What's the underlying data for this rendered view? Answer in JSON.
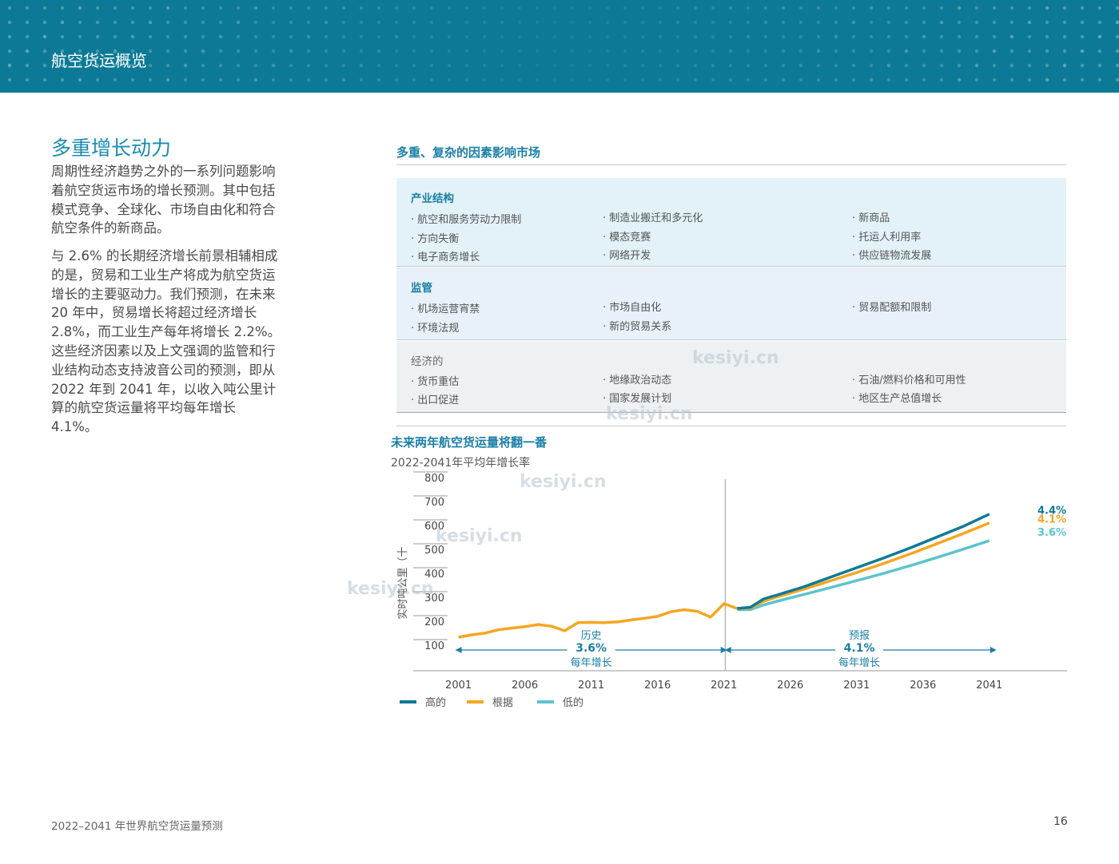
{
  "header": {
    "title": "航空货运概览"
  },
  "left": {
    "heading": "多重增长动力",
    "paragraph1": "周期性经济趋势之外的一系列问题影响着航空货运市场的增长预测。其中包括模式竞争、全球化、市场自由化和符合航空条件的新商品。",
    "paragraph2": "与 2.6% 的长期经济增长前景相辅相成的是，贸易和工业生产将成为航空货运增长的主要驱动力。我们预测，在未来 20 年中，贸易增长将超过经济增长 2.8%，而工业生产每年将增长 2.2%。这些经济因素以及上文强调的监管和行业结构动态支持波音公司的预测，即从 2022 年到 2041 年，以收入吨公里计算的航空货运量将平均每年增长 4.1%。"
  },
  "factors": {
    "title": "多重、复杂的因素影响市场",
    "industry": {
      "title": "产业结构",
      "col1": [
        "航空和服务劳动力限制",
        "方向失衡",
        "电子商务增长"
      ],
      "col2": [
        "制造业搬迁和多元化",
        "模态竞赛",
        "网络开发"
      ],
      "col3": [
        "新商品",
        "托运人利用率",
        "供应链物流发展"
      ]
    },
    "regulation": {
      "title": "监管",
      "col1": [
        "机场运营宵禁",
        "环境法规"
      ],
      "col2": [
        "市场自由化",
        "新的贸易关系"
      ],
      "col3": [
        "贸易配额和限制"
      ]
    },
    "economic": {
      "title": "经济的",
      "col1": [
        "货币重估",
        "出口促进"
      ],
      "col2": [
        "地缘政治动态",
        "国家发展计划"
      ],
      "col3": [
        "石油/燃料价格和可用性",
        "地区生产总值增长"
      ]
    }
  },
  "chart": {
    "title": "未来两年航空货运量将翻一番",
    "subtitle": "2022-2041年平均年增长率"
  },
  "chart_data": {
    "type": "line",
    "title": "未来两年航空货运量将翻一番",
    "subtitle": "2022-2041年平均年增长率",
    "ylabel": "实时吨公里（十",
    "ylim": [
      0,
      800
    ],
    "y_ticks": [
      100,
      200,
      300,
      400,
      500,
      600,
      700,
      800
    ],
    "x_ticks": [
      2001,
      2006,
      2011,
      2016,
      2021,
      2026,
      2031,
      2036,
      2041
    ],
    "xlim": [
      2000,
      2043
    ],
    "history": {
      "color": "#f5a623",
      "x": [
        2001,
        2002,
        2003,
        2004,
        2005,
        2006,
        2007,
        2008,
        2009,
        2010,
        2011,
        2012,
        2013,
        2014,
        2015,
        2016,
        2017,
        2018,
        2019,
        2020,
        2021,
        2022
      ],
      "y": [
        140,
        150,
        157,
        171,
        178,
        184,
        193,
        186,
        167,
        201,
        202,
        201,
        204,
        212,
        219,
        227,
        246,
        255,
        248,
        224,
        280,
        260
      ]
    },
    "series": [
      {
        "name": "高的",
        "color": "#0f7a97",
        "x": [
          2022,
          2023,
          2024,
          2025,
          2027,
          2029,
          2031,
          2033,
          2035,
          2037,
          2039,
          2041
        ],
        "y": [
          260,
          265,
          300,
          316,
          350,
          390,
          430,
          470,
          512,
          557,
          602,
          654
        ]
      },
      {
        "name": "根据",
        "color": "#f5a623",
        "x": [
          2022,
          2023,
          2024,
          2025,
          2027,
          2029,
          2031,
          2033,
          2035,
          2037,
          2039,
          2041
        ],
        "y": [
          260,
          262,
          290,
          308,
          340,
          375,
          410,
          447,
          487,
          529,
          572,
          617
        ]
      },
      {
        "name": "低的",
        "color": "#5bc4cf",
        "x": [
          2022,
          2023,
          2024,
          2025,
          2027,
          2029,
          2031,
          2033,
          2035,
          2037,
          2039,
          2041
        ],
        "y": [
          255,
          255,
          275,
          290,
          318,
          347,
          376,
          406,
          438,
          472,
          507,
          543
        ]
      }
    ],
    "end_labels": [
      {
        "text": "4.4%",
        "color": "#0f7a97",
        "y": 669
      },
      {
        "text": "4.1%",
        "color": "#f5a623",
        "y": 632
      },
      {
        "text": "3.6%",
        "color": "#5bc4cf",
        "y": 576
      }
    ],
    "divider_year": 2021.1,
    "annotations": [
      {
        "label": "历史",
        "rate": "3.6%",
        "unit": "每年增长",
        "x_center": 2011,
        "arrow_from": 2001,
        "arrow_to": 2021
      },
      {
        "label": "预报",
        "rate": "4.1%",
        "unit": "每年增长",
        "x_center": 2031.2,
        "arrow_from": 2021.3,
        "arrow_to": 2041.3
      }
    ],
    "legend": [
      "高的",
      "根据",
      "低的"
    ],
    "legend_position": "bottom-left",
    "grid": false
  },
  "watermarks": [
    "kesiyi.cn",
    "kesiyi.cn",
    "kesiyi.cn",
    "kesiyi.cn",
    "kesiyi.cn"
  ],
  "footer": {
    "text": "2022–2041 年世界航空货运量预测",
    "page": "16"
  }
}
